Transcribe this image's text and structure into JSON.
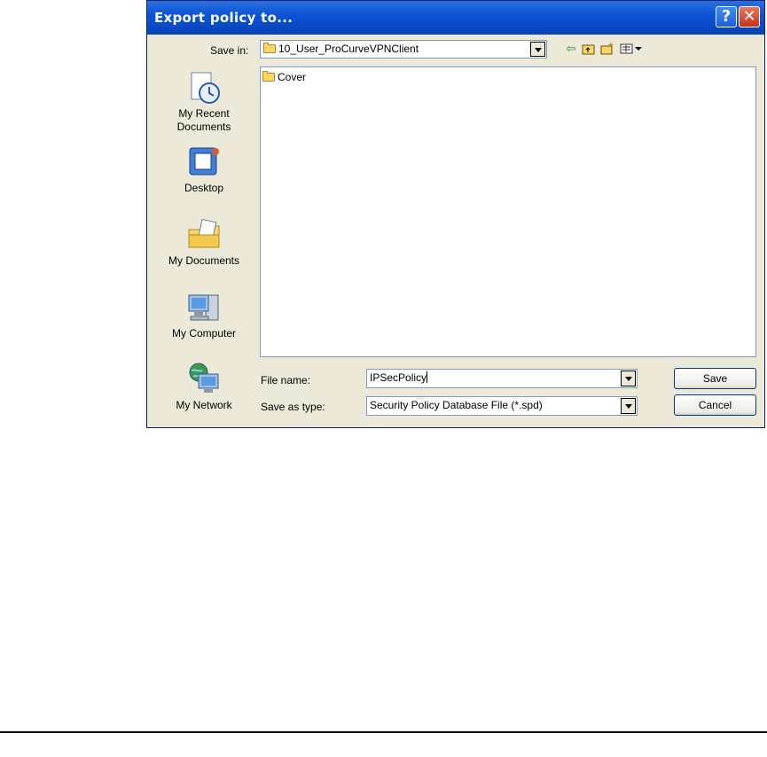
{
  "dialog": {
    "title": "Export policy to...",
    "help_glyph": "?",
    "close_glyph": "✕"
  },
  "save_in": {
    "label": "Save in:",
    "value": "10_User_ProCurveVPNClient",
    "icon": "folder-icon"
  },
  "toolbar": {
    "back_icon": "back-arrow-icon",
    "up_icon": "up-folder-icon",
    "new_folder_icon": "new-folder-icon",
    "views_icon": "views-menu-icon"
  },
  "places": [
    {
      "line1": "My Recent",
      "line2": "Documents",
      "icon": "recent-documents-icon"
    },
    {
      "line1": "Desktop",
      "line2": "",
      "icon": "desktop-icon"
    },
    {
      "line1": "My Documents",
      "line2": "",
      "icon": "my-documents-icon"
    },
    {
      "line1": "My Computer",
      "line2": "",
      "icon": "my-computer-icon"
    },
    {
      "line1": "My Network",
      "line2": "",
      "icon": "my-network-icon"
    }
  ],
  "files": [
    {
      "name": "Cover",
      "type": "folder"
    }
  ],
  "file_name": {
    "label": "File name:",
    "value": "IPSecPolicy"
  },
  "save_as_type": {
    "label": "Save as type:",
    "value": "Security Policy Database File (*.spd)"
  },
  "buttons": {
    "save": "Save",
    "cancel": "Cancel"
  }
}
